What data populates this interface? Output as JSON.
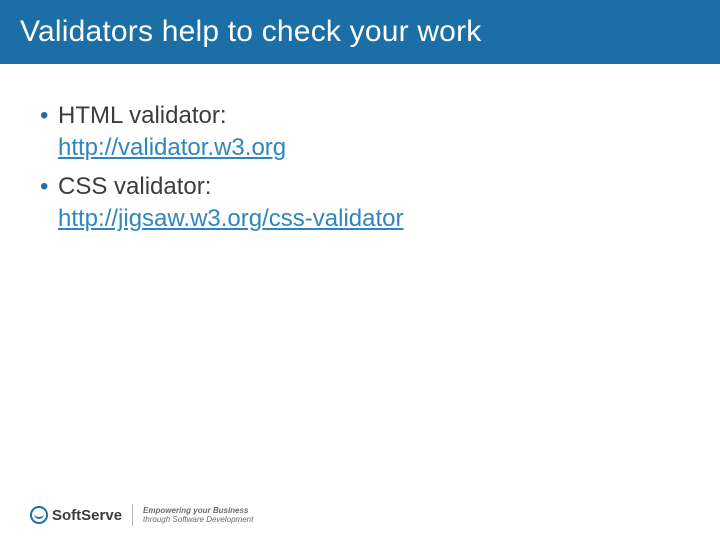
{
  "title": "Validators help to check your work",
  "bullets": [
    {
      "label": "HTML validator:",
      "link": "http://validator.w3.org"
    },
    {
      "label": "CSS validator:",
      "link": "http://jigsaw.w3.org/css-validator"
    }
  ],
  "footer": {
    "brand_part1": "Soft",
    "brand_part2": "Serve",
    "tagline_line1": "Empowering your Business",
    "tagline_line2": "through Software Development"
  }
}
